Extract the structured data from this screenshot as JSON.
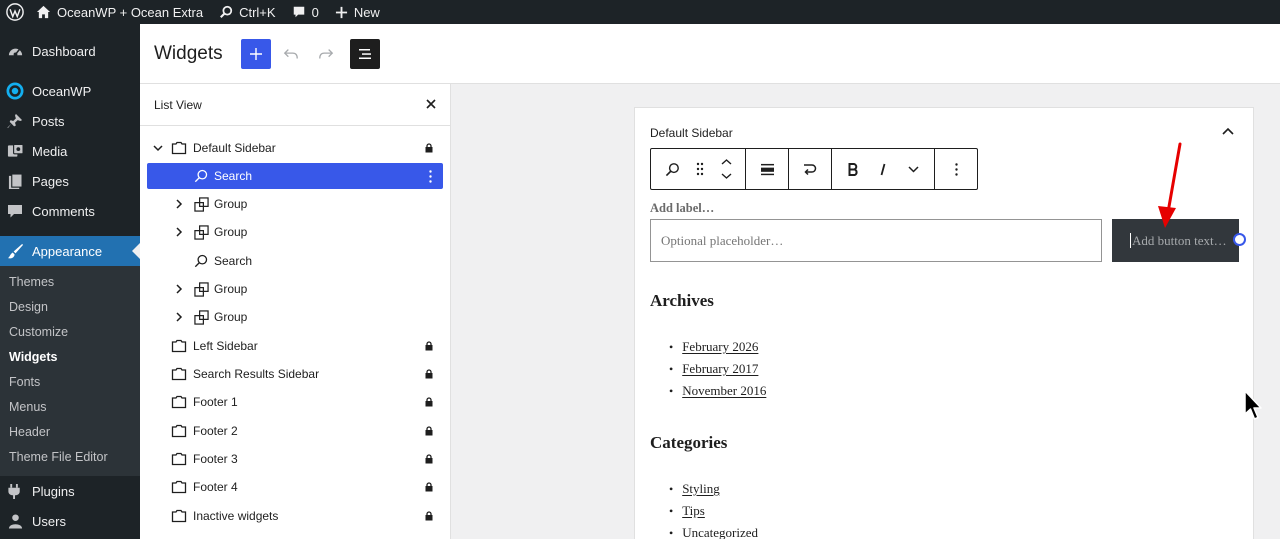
{
  "admin_bar": {
    "site_name": "OceanWP + Ocean Extra",
    "shortcut": "Ctrl+K",
    "comments_count": "0",
    "new_label": "New"
  },
  "admin_menu": {
    "top_items": [
      {
        "label": "Dashboard",
        "icon": "dashboard-icon"
      },
      {
        "label": "OceanWP",
        "icon": "oceanwp-icon"
      },
      {
        "label": "Posts",
        "icon": "pin-icon"
      },
      {
        "label": "Media",
        "icon": "media-icon"
      },
      {
        "label": "Pages",
        "icon": "pages-icon"
      },
      {
        "label": "Comments",
        "icon": "comments-icon"
      }
    ],
    "appearance": {
      "label": "Appearance",
      "icon": "paintbrush-icon"
    },
    "submenu": [
      "Themes",
      "Design",
      "Customize",
      "Widgets",
      "Fonts",
      "Menus",
      "Header",
      "Theme File Editor"
    ],
    "current_submenu": "Widgets",
    "bottom_items": [
      {
        "label": "Plugins",
        "icon": "plugins-icon"
      },
      {
        "label": "Users",
        "icon": "users-icon"
      }
    ]
  },
  "editor": {
    "title": "Widgets"
  },
  "list_view": {
    "title": "List View",
    "rows": [
      {
        "label": "Default Sidebar",
        "type": "area",
        "expanded": true,
        "locked": true
      },
      {
        "label": "Search",
        "type": "search",
        "selected": true
      },
      {
        "label": "Group",
        "type": "group"
      },
      {
        "label": "Group",
        "type": "group"
      },
      {
        "label": "Search",
        "type": "search"
      },
      {
        "label": "Group",
        "type": "group"
      },
      {
        "label": "Group",
        "type": "group"
      },
      {
        "label": "Left Sidebar",
        "type": "area",
        "locked": true
      },
      {
        "label": "Search Results Sidebar",
        "type": "area",
        "locked": true
      },
      {
        "label": "Footer 1",
        "type": "area",
        "locked": true
      },
      {
        "label": "Footer 2",
        "type": "area",
        "locked": true
      },
      {
        "label": "Footer 3",
        "type": "area",
        "locked": true
      },
      {
        "label": "Footer 4",
        "type": "area",
        "locked": true
      },
      {
        "label": "Inactive widgets",
        "type": "area",
        "locked": true
      }
    ]
  },
  "widget_area": {
    "title": "Default Sidebar",
    "search_block": {
      "label_placeholder": "Add label…",
      "input_placeholder": "Optional placeholder…",
      "button_placeholder": "Add button text…"
    },
    "archives": {
      "heading": "Archives",
      "items": [
        "February 2026",
        "February 2017",
        "November 2016"
      ]
    },
    "categories": {
      "heading": "Categories",
      "items": [
        "Styling",
        "Tips",
        "Uncategorized"
      ]
    }
  },
  "colors": {
    "accent": "#3858e9",
    "admin_bg": "#1d2327",
    "menu_active": "#2271b1",
    "annotation": "#e60000"
  }
}
